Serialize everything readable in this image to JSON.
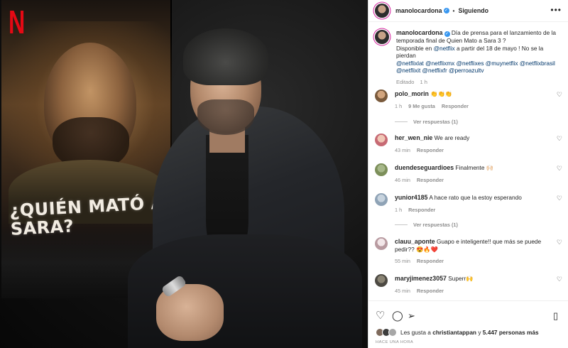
{
  "header": {
    "username": "manolocardona",
    "verified_mark": "✓",
    "separator": "•",
    "follow_status": "Siguiendo",
    "more": "•••"
  },
  "poster": {
    "logo": "N",
    "title": "¿QUIÉN MATÓ A SARA?"
  },
  "caption": {
    "username": "manolocardona",
    "text_1": "Día de prensa para el lanzamiento de la temporada final de Quien Mato a Sara 3 ?",
    "text_2": "Disponible en",
    "mention_1": "@netflix",
    "text_3": "a partir del 18 de mayo ! No se la pierdan",
    "mentions_rest": "@netflixlat @netflixmx @netflixes @muynetflix @netflixbrasil @netflixit @netflixfr @perroazultv",
    "edited": "Editado",
    "time": "1 h"
  },
  "comments": [
    {
      "username": "polo_morin",
      "text": "👏👏👏",
      "time": "1 h",
      "likes": "9 Me gusta",
      "reply": "Responder",
      "view_replies": "Ver respuestas (1)",
      "avatar_color": "#7a5a3c"
    },
    {
      "username": "her_wen_nie",
      "text": "We are ready",
      "time": "43 min",
      "reply": "Responder",
      "avatar_color": "#c76a74"
    },
    {
      "username": "duendeseguardioes",
      "text": "Finalmente 🙌🏻",
      "time": "46 min",
      "reply": "Responder",
      "avatar_color": "#7c8f5a"
    },
    {
      "username": "yunior4185",
      "text": "A hace rato que la estoy esperando",
      "time": "1 h",
      "reply": "Responder",
      "view_replies": "Ver respuestas (1)",
      "avatar_color": "#8fa3b6"
    },
    {
      "username": "clauu_aponte",
      "text": "Guapo e inteligente!! que más se puede pedir?? 😍🔥❤️",
      "time": "55 min",
      "reply": "Responder",
      "avatar_color": "#d8c6c9"
    },
    {
      "username": "maryjimenez3057",
      "text": "Superr🙌",
      "time": "45 min",
      "reply": "Responder",
      "avatar_color": "#4d4a43"
    }
  ],
  "icons": {
    "heart": "♡",
    "comment": "◯",
    "share": "➢",
    "bookmark": "▯"
  },
  "likes": {
    "prefix": "Les gusta a",
    "user": "christiantappan",
    "conj": "y",
    "count": "5.447 personas más"
  },
  "posted_ago": "HACE UNA HORA"
}
